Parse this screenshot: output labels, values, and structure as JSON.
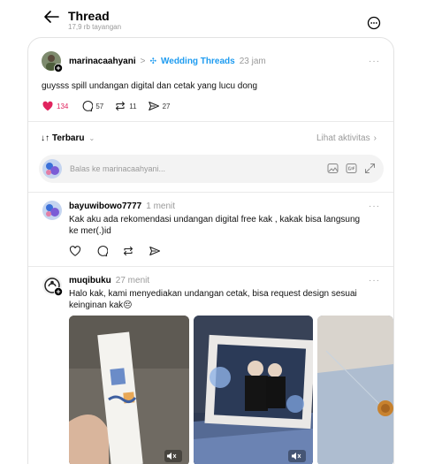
{
  "header": {
    "title": "Thread",
    "subtitle": "17,9 rb tayangan"
  },
  "post": {
    "username": "marinacaahyani",
    "separator": ">",
    "community": "Wedding Threads",
    "time": "23 jam",
    "text": "guysss spill undangan digital dan cetak yang lucu dong",
    "likes": "134",
    "comments": "57",
    "reposts": "11",
    "shares": "27",
    "more": "···"
  },
  "filter": {
    "sort_label": "Terbaru",
    "activity_link": "Lihat aktivitas"
  },
  "reply_box": {
    "placeholder": "Balas ke marinacaahyani..."
  },
  "comments": [
    {
      "username": "bayuwibowo7777",
      "time": "1 menit",
      "text_line1": "Kak aku ada rekomendasi undangan digital free kak , kakak bisa langsung",
      "text_line2": "ke mer(.)id"
    },
    {
      "username": "muqibuku",
      "time": "27 menit",
      "text_line1": "Halo kak, kami menyediakan undangan cetak, bisa request design sesuai",
      "text_line2": "keinginan kak😔"
    }
  ],
  "colors": {
    "like_red": "#e0245e",
    "link_blue": "#1d9bf0",
    "muted": "#9a9a9a"
  }
}
